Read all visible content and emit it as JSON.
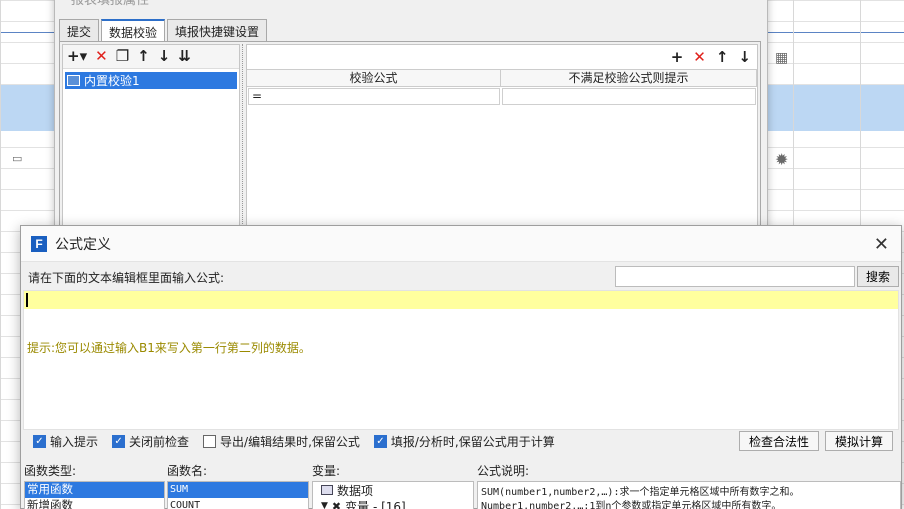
{
  "back_dialog": {
    "title": "报表填报属性",
    "tabs": [
      {
        "label": "提交",
        "active": false
      },
      {
        "label": "数据校验",
        "active": true
      },
      {
        "label": "填报快捷键设置",
        "active": false
      }
    ],
    "tree_items": [
      "内置校验1"
    ],
    "grid_headers": [
      "校验公式",
      "不满足校验公式则提示"
    ],
    "grid_row": {
      "formula": "=",
      "message": ""
    }
  },
  "dialog": {
    "title": "公式定义",
    "prompt": "请在下面的文本编辑框里面输入公式:",
    "search_placeholder": "",
    "search_button": "搜索",
    "editor_value": "",
    "hint": "提示:您可以通过输入B1来写入第一行第二列的数据。",
    "options": [
      {
        "label": "输入提示",
        "checked": true
      },
      {
        "label": "关闭前检查",
        "checked": true
      },
      {
        "label": "导出/编辑结果时,保留公式",
        "checked": false
      },
      {
        "label": "填报/分析时,保留公式用于计算",
        "checked": true
      }
    ],
    "check_button": "检查合法性",
    "simulate_button": "模拟计算",
    "labels": {
      "func_type": "函数类型:",
      "func_name": "函数名:",
      "variable": "变量:",
      "description": "公式说明:"
    },
    "func_types": [
      "常用函数",
      "新增函数"
    ],
    "func_names": [
      "SUM",
      "COUNT"
    ],
    "variables": [
      "数据项",
      "变量 - [16]"
    ],
    "description_lines": [
      "SUM(number1,number2,…):求一个指定单元格区域中所有数字之和。",
      "Number1,number2,…:1到n个参数或指定单元格区域中所有数字。"
    ]
  }
}
